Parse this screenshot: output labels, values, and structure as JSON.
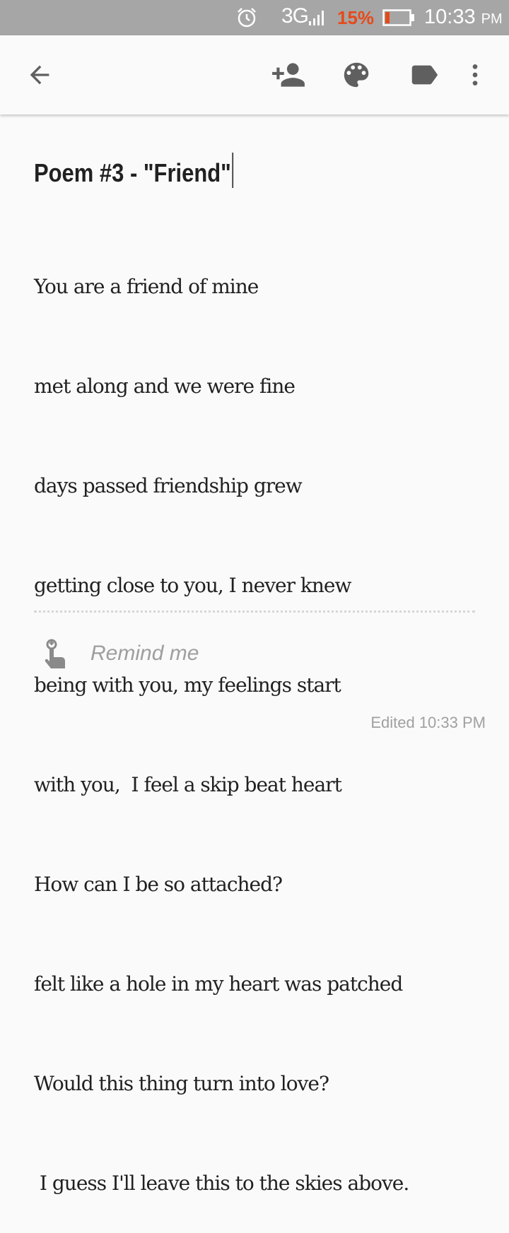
{
  "status_bar": {
    "network": "3G",
    "battery_percent": "15%",
    "time": "10:33",
    "ampm": "PM",
    "battery_color": "#e64a19"
  },
  "toolbar": {
    "icons": [
      "back-arrow-icon",
      "add-collaborator-icon",
      "palette-icon",
      "label-icon",
      "more-vert-icon"
    ]
  },
  "note": {
    "title": "Poem #3 - \"Friend\"",
    "lines": [
      "You are a friend of mine",
      "met along and we were fine",
      "days passed friendship grew",
      "getting close to you, I never knew",
      "being with you, my feelings start",
      "with you,  I feel a skip beat heart",
      "How can I be so attached?",
      "felt like a hole in my heart was patched",
      "Would this thing turn into love?",
      " I guess I'll leave this to the skies above."
    ]
  },
  "reminder": {
    "placeholder": "Remind me",
    "icon": "remind-finger-icon"
  },
  "footer": {
    "edited": "Edited 10:33 PM"
  }
}
